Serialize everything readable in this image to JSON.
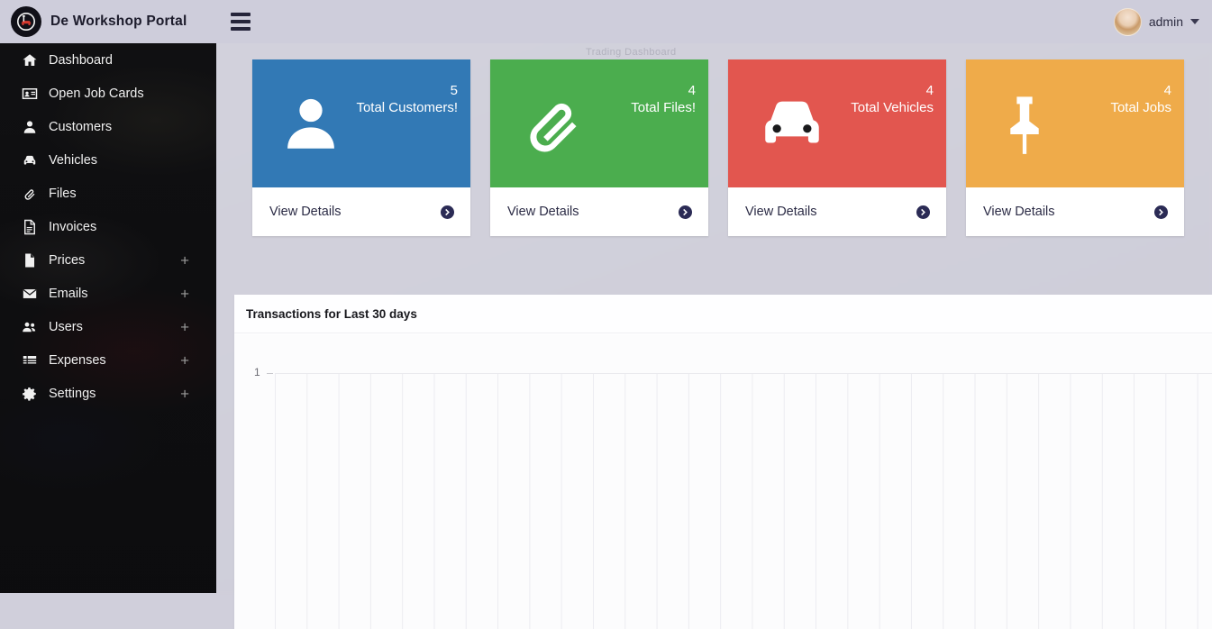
{
  "header": {
    "brand_title": "De Workshop Portal",
    "menu_toggle_icon": "hamburger-icon",
    "user_name": "admin",
    "avatar_icon": "user-avatar",
    "caret_icon": "chevron-down-icon",
    "background_hex": "#cecddb"
  },
  "background": {
    "faint_text": "Trading Dashboard"
  },
  "sidebar": {
    "items": [
      {
        "label": "Dashboard",
        "icon": "home-icon",
        "expandable": false,
        "plus": ""
      },
      {
        "label": "Open Job Cards",
        "icon": "id-card-icon",
        "expandable": false,
        "plus": ""
      },
      {
        "label": "Customers",
        "icon": "user-icon",
        "expandable": false,
        "plus": ""
      },
      {
        "label": "Vehicles",
        "icon": "car-icon",
        "expandable": false,
        "plus": ""
      },
      {
        "label": "Files",
        "icon": "paperclip-icon",
        "expandable": false,
        "plus": ""
      },
      {
        "label": "Invoices",
        "icon": "invoice-icon",
        "expandable": false,
        "plus": ""
      },
      {
        "label": "Prices",
        "icon": "page-icon",
        "expandable": true,
        "plus": "+"
      },
      {
        "label": "Emails",
        "icon": "envelope-icon",
        "expandable": true,
        "plus": "+"
      },
      {
        "label": "Users",
        "icon": "users-icon",
        "expandable": true,
        "plus": "+"
      },
      {
        "label": "Expenses",
        "icon": "list-icon",
        "expandable": true,
        "plus": "+"
      },
      {
        "label": "Settings",
        "icon": "gear-icon",
        "expandable": true,
        "plus": "+"
      }
    ]
  },
  "cards": [
    {
      "count": "5",
      "caption": "Total Customers!",
      "icon": "user-icon",
      "color": "#3279b5",
      "footer_label": "View Details",
      "arrow_icon": "arrow-circle-right-icon"
    },
    {
      "count": "4",
      "caption": "Total Files!",
      "icon": "paperclip-icon",
      "color": "#4bad4e",
      "footer_label": "View Details",
      "arrow_icon": "arrow-circle-right-icon"
    },
    {
      "count": "4",
      "caption": "Total Vehicles",
      "icon": "car-icon",
      "color": "#e2564f",
      "footer_label": "View Details",
      "arrow_icon": "arrow-circle-right-icon"
    },
    {
      "count": "4",
      "caption": "Total Jobs",
      "icon": "pushpin-icon",
      "color": "#efab4a",
      "footer_label": "View Details",
      "arrow_icon": "arrow-circle-right-icon"
    }
  ],
  "chart_panel": {
    "title": "Transactions for Last 30 days"
  },
  "chart_data": {
    "type": "line",
    "title": "Transactions for Last 30 days",
    "xlabel": "",
    "ylabel": "",
    "categories": [],
    "series": [
      {
        "name": "Transactions",
        "values": []
      }
    ],
    "ytick_labels": [
      "1"
    ],
    "ylim": [
      0,
      1
    ],
    "grid": true,
    "gridlines_vertical": 30,
    "legend": "none",
    "note": "empty plot area - no data points rendered"
  }
}
